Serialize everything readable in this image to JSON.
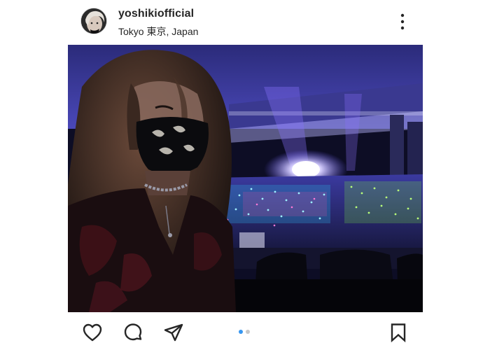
{
  "post": {
    "username": "yoshikiofficial",
    "location": "Tokyo 東京, Japan",
    "carousel": {
      "slide_count": 2,
      "active_index": 0
    }
  },
  "icons": {
    "more": "more-vertical-icon",
    "like": "heart-icon",
    "comment": "comment-bubble-icon",
    "share": "paper-plane-icon",
    "save": "bookmark-icon"
  },
  "colors": {
    "text": "#262626",
    "active_dot": "#3897f0",
    "inactive_dot": "#c7c7c7"
  }
}
